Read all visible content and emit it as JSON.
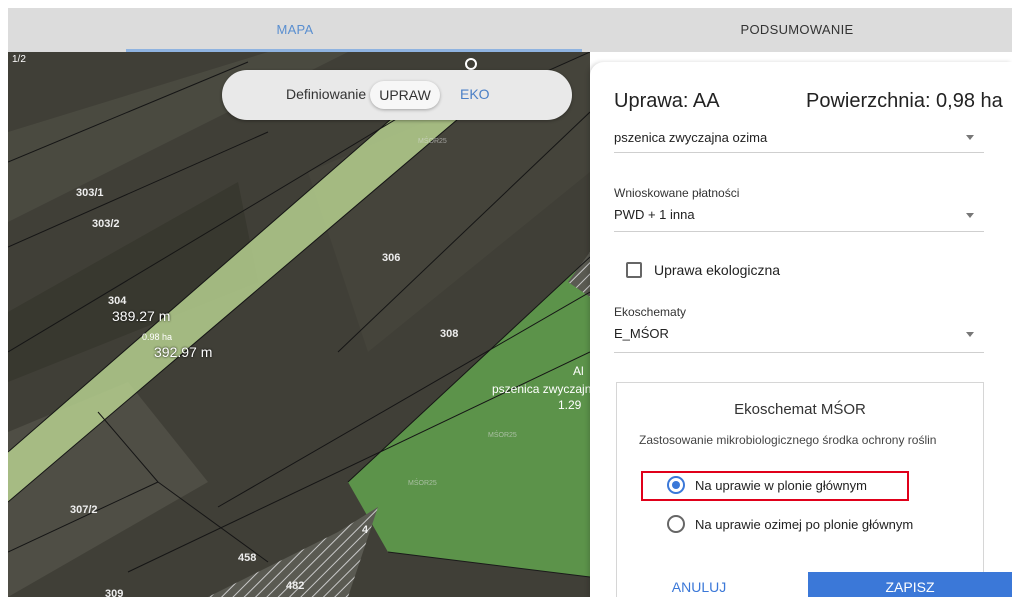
{
  "tabs": {
    "map": "MAPA",
    "summary": "PODSUMOWANIE"
  },
  "map": {
    "toggle": {
      "label": "Definiowanie",
      "upraw": "UPRAW",
      "eko": "EKO"
    },
    "parcels": [
      "303/1",
      "303/2",
      "306",
      "304",
      "308",
      "307/2",
      "458",
      "482",
      "309",
      "4",
      "1/2"
    ],
    "measure_1": "389.27 m",
    "measure_2": "392.97 m",
    "area_label": "0.98 ha",
    "side_label_1": "pszenica zwyczajna",
    "side_label_2": "1.29",
    "side_label_3": "Al",
    "hatch_label": "MŚOR25"
  },
  "panel": {
    "title": "Uprawa: AA",
    "area": "Powierzchnia: 0,98 ha",
    "crop_value": "pszenica zwyczajna ozima",
    "payments_label": "Wnioskowane płatności",
    "payments_value": "PWD + 1 inna",
    "organic_label": "Uprawa ekologiczna",
    "eco_label": "Ekoschematy",
    "eco_value": "E_MŚOR",
    "box_title": "Ekoschemat MŚOR",
    "box_desc": "Zastosowanie mikrobiologicznego środka ochrony roślin",
    "radio_1": "Na uprawie w plonie głównym",
    "radio_2": "Na uprawie ozimej po plonie głównym",
    "radio_selected": 1,
    "cancel": "ANULUJ",
    "save": "ZAPISZ"
  },
  "colors": {
    "accent": "#3b78d8",
    "highlight": "#e0001a",
    "strip": "#b5cf8e",
    "field_green": "#5f9c4d"
  }
}
